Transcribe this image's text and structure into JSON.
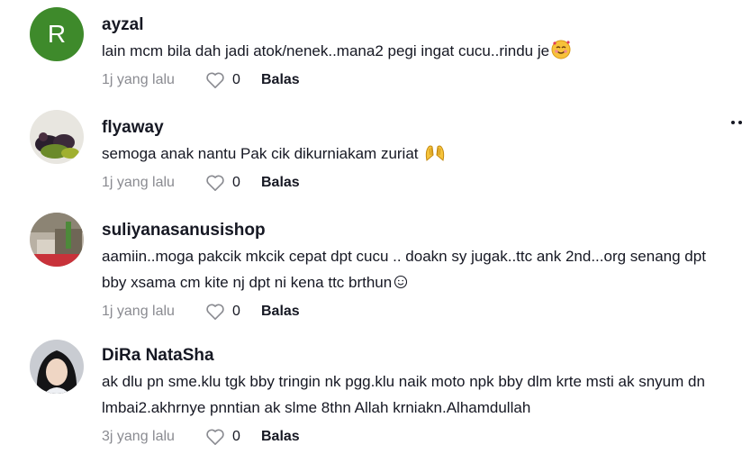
{
  "comments": [
    {
      "username": "ayzal",
      "avatar_letter": "R",
      "text": "lain mcm bila dah jadi atok/nenek..mana2 pegi ingat cucu..rindu je",
      "emoji": "smiling-face-with-hearts-icon",
      "time": "1j yang lalu",
      "likes": "0",
      "reply_label": "Balas"
    },
    {
      "username": "flyaway",
      "text": "semoga anak nantu Pak cik dikurniakam zuriat",
      "emoji": "raised-hands-icon",
      "time": "1j yang lalu",
      "likes": "0",
      "reply_label": "Balas"
    },
    {
      "username": "suliyanasanusishop",
      "text": "aamiin..moga pakcik mkcik cepat dpt cucu .. doakn sy jugak..ttc ank 2nd...org senang dpt bby xsama cm kite nj dpt ni kena ttc brthun",
      "emoji": "smiley-icon",
      "time": "1j yang lalu",
      "likes": "0",
      "reply_label": "Balas"
    },
    {
      "username": "DiRa NataSha",
      "text": "ak dlu pn sme.klu tgk bby tringin nk pgg.klu naik moto npk bby dlm krte msti ak snyum dn lmbai2.akhrnye pnntian ak slme 8thn Allah krniakn.Alhamdullah",
      "time": "3j yang lalu",
      "likes": "0",
      "reply_label": "Balas"
    }
  ],
  "icons": {
    "like": "heart-outline-icon",
    "more": "more-options-icon"
  },
  "colors": {
    "avatar_bg": "#3e8a2b",
    "meta_gray": "#8a8b91",
    "text": "#161823"
  }
}
